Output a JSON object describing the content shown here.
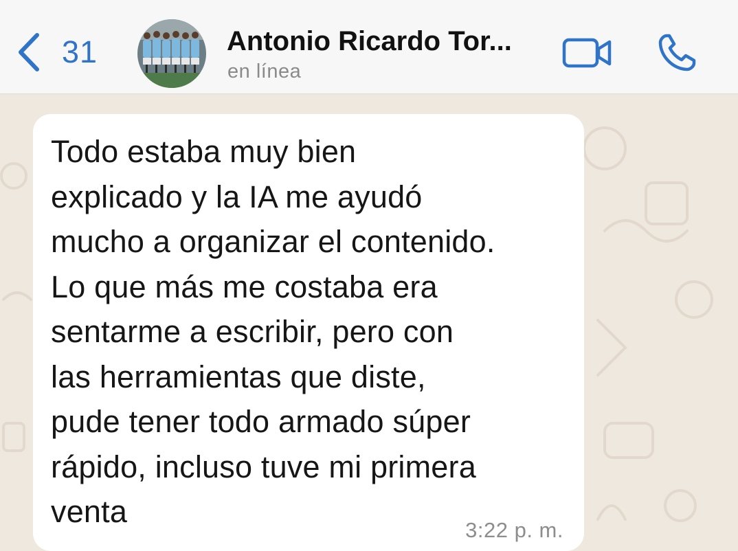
{
  "header": {
    "back_count": "31",
    "contact_name": "Antonio Ricardo Tor...",
    "status": "en línea",
    "icons": {
      "back": "chevron-left-icon",
      "video": "video-camera-icon",
      "call": "phone-icon"
    }
  },
  "message": {
    "lines": [
      "Todo estaba muy bien",
      "explicado y la IA me ayudó",
      "mucho a organizar el contenido.",
      "Lo que más me costaba era",
      "sentarme a escribir, pero con",
      "las herramientas que diste,",
      "pude tener todo armado súper",
      "rápido, incluso tuve mi primera",
      "venta"
    ],
    "time": "3:22 p. m."
  },
  "colors": {
    "accent": "#2f74c8",
    "header_bg": "#f7f7f7",
    "chat_bg": "#efe8de",
    "bubble_bg": "#ffffff",
    "secondary_text": "#8a8a8a"
  }
}
